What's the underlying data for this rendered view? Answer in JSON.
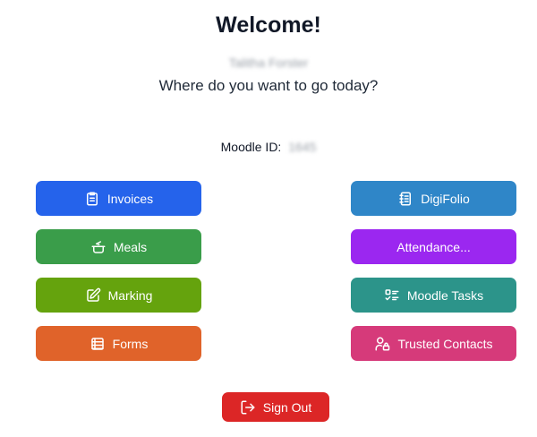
{
  "header": {
    "title": "Welcome!",
    "user_name": "Talitha Forster",
    "subtitle": "Where do you want to go today?"
  },
  "moodle": {
    "label": "Moodle ID:",
    "value": "1645"
  },
  "left_buttons": [
    {
      "label": "Invoices",
      "icon": "clipboard-list-icon",
      "color": "#2563eb"
    },
    {
      "label": "Meals",
      "icon": "cooking-pot-icon",
      "color": "#3a9d4a"
    },
    {
      "label": "Marking",
      "icon": "edit-square-icon",
      "color": "#65a30d"
    },
    {
      "label": "Forms",
      "icon": "list-table-icon",
      "color": "#e0632a"
    }
  ],
  "right_buttons": [
    {
      "label": "DigiFolio",
      "icon": "notebook-icon",
      "color": "#2f86c8"
    },
    {
      "label": "Attendance...",
      "icon": "",
      "color": "#9b27f0"
    },
    {
      "label": "Moodle Tasks",
      "icon": "task-list-icon",
      "color": "#2c948a"
    },
    {
      "label": "Trusted Contacts",
      "icon": "user-lock-icon",
      "color": "#d63a7a"
    }
  ],
  "signout": {
    "label": "Sign Out",
    "icon": "sign-out-icon",
    "color": "#dc2626"
  }
}
